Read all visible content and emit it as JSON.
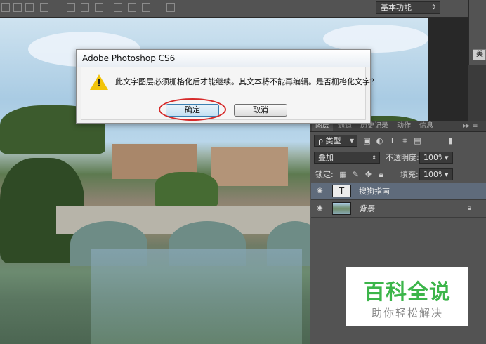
{
  "options_bar": {
    "workspace_label": "基本功能",
    "workspace_arrow": "⇕"
  },
  "right_strip": {
    "button_label": "美"
  },
  "dialog": {
    "title": "Adobe Photoshop CS6",
    "message": "此文字图层必须栅格化后才能继续。其文本将不能再编辑。是否栅格化文字？",
    "ok_label": "确定",
    "cancel_label": "取消",
    "icon": "warning-icon",
    "highlight_color": "#d62a2a"
  },
  "layers_panel": {
    "tabs": [
      "图层",
      "通道",
      "历史记录",
      "动作",
      "信息"
    ],
    "active_tab": "图层",
    "filter_label": "ρ 类型",
    "blend_mode": "叠加",
    "opacity_label": "不透明度:",
    "opacity_value": "100%",
    "lock_label": "锁定:",
    "fill_label": "填充:",
    "fill_value": "100%",
    "layers": [
      {
        "name": "搜狗指南",
        "type": "text",
        "thumb": "T",
        "selected": true
      },
      {
        "name": "背景",
        "type": "image",
        "locked": true,
        "selected": false
      }
    ]
  },
  "watermark": {
    "main": "百科全说",
    "sub": "助你轻松解决",
    "color": "#3cb54a"
  }
}
